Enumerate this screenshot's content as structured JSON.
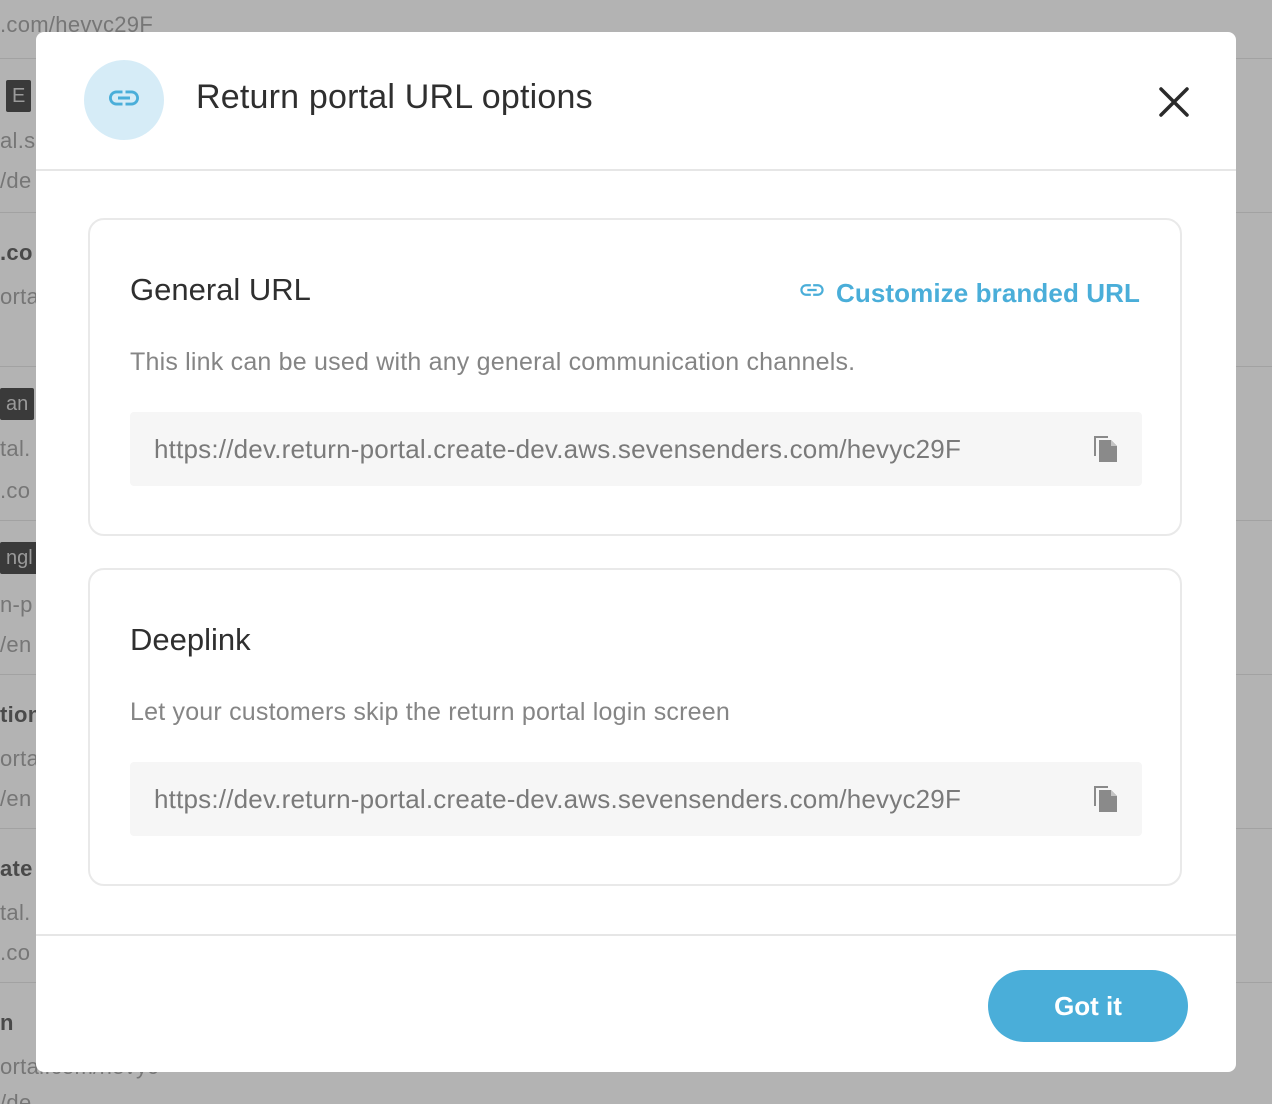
{
  "background": {
    "texts": [
      ".com/hevyc29F",
      "E",
      "al.s",
      "/de",
      ".co",
      "orta",
      "an",
      "tal.",
      ".co",
      "ngl",
      "n-p",
      "/en",
      "tion",
      "orta",
      "/en",
      "ate",
      "tal.",
      ".co",
      "n",
      "ortal.com/hevyc",
      "/de"
    ]
  },
  "modal": {
    "title": "Return portal URL options",
    "header_icon": "link-icon",
    "close_icon": "close-icon",
    "general": {
      "title": "General URL",
      "branded_link_label": "Customize branded URL",
      "description": "This link can be used with any general communication channels.",
      "url": "https://dev.return-portal.create-dev.aws.sevensenders.com/hevyc29F",
      "copy_icon": "copy-icon"
    },
    "deeplink": {
      "title": "Deeplink",
      "description": "Let your customers skip the return portal login screen",
      "url": "https://dev.return-portal.create-dev.aws.sevensenders.com/hevyc29F",
      "copy_icon": "copy-icon"
    },
    "footer": {
      "got_it_label": "Got it"
    }
  },
  "colors": {
    "accent": "#4aaed9",
    "icon_bg": "#d6ecf7",
    "overlay": "#b3b3b3"
  }
}
